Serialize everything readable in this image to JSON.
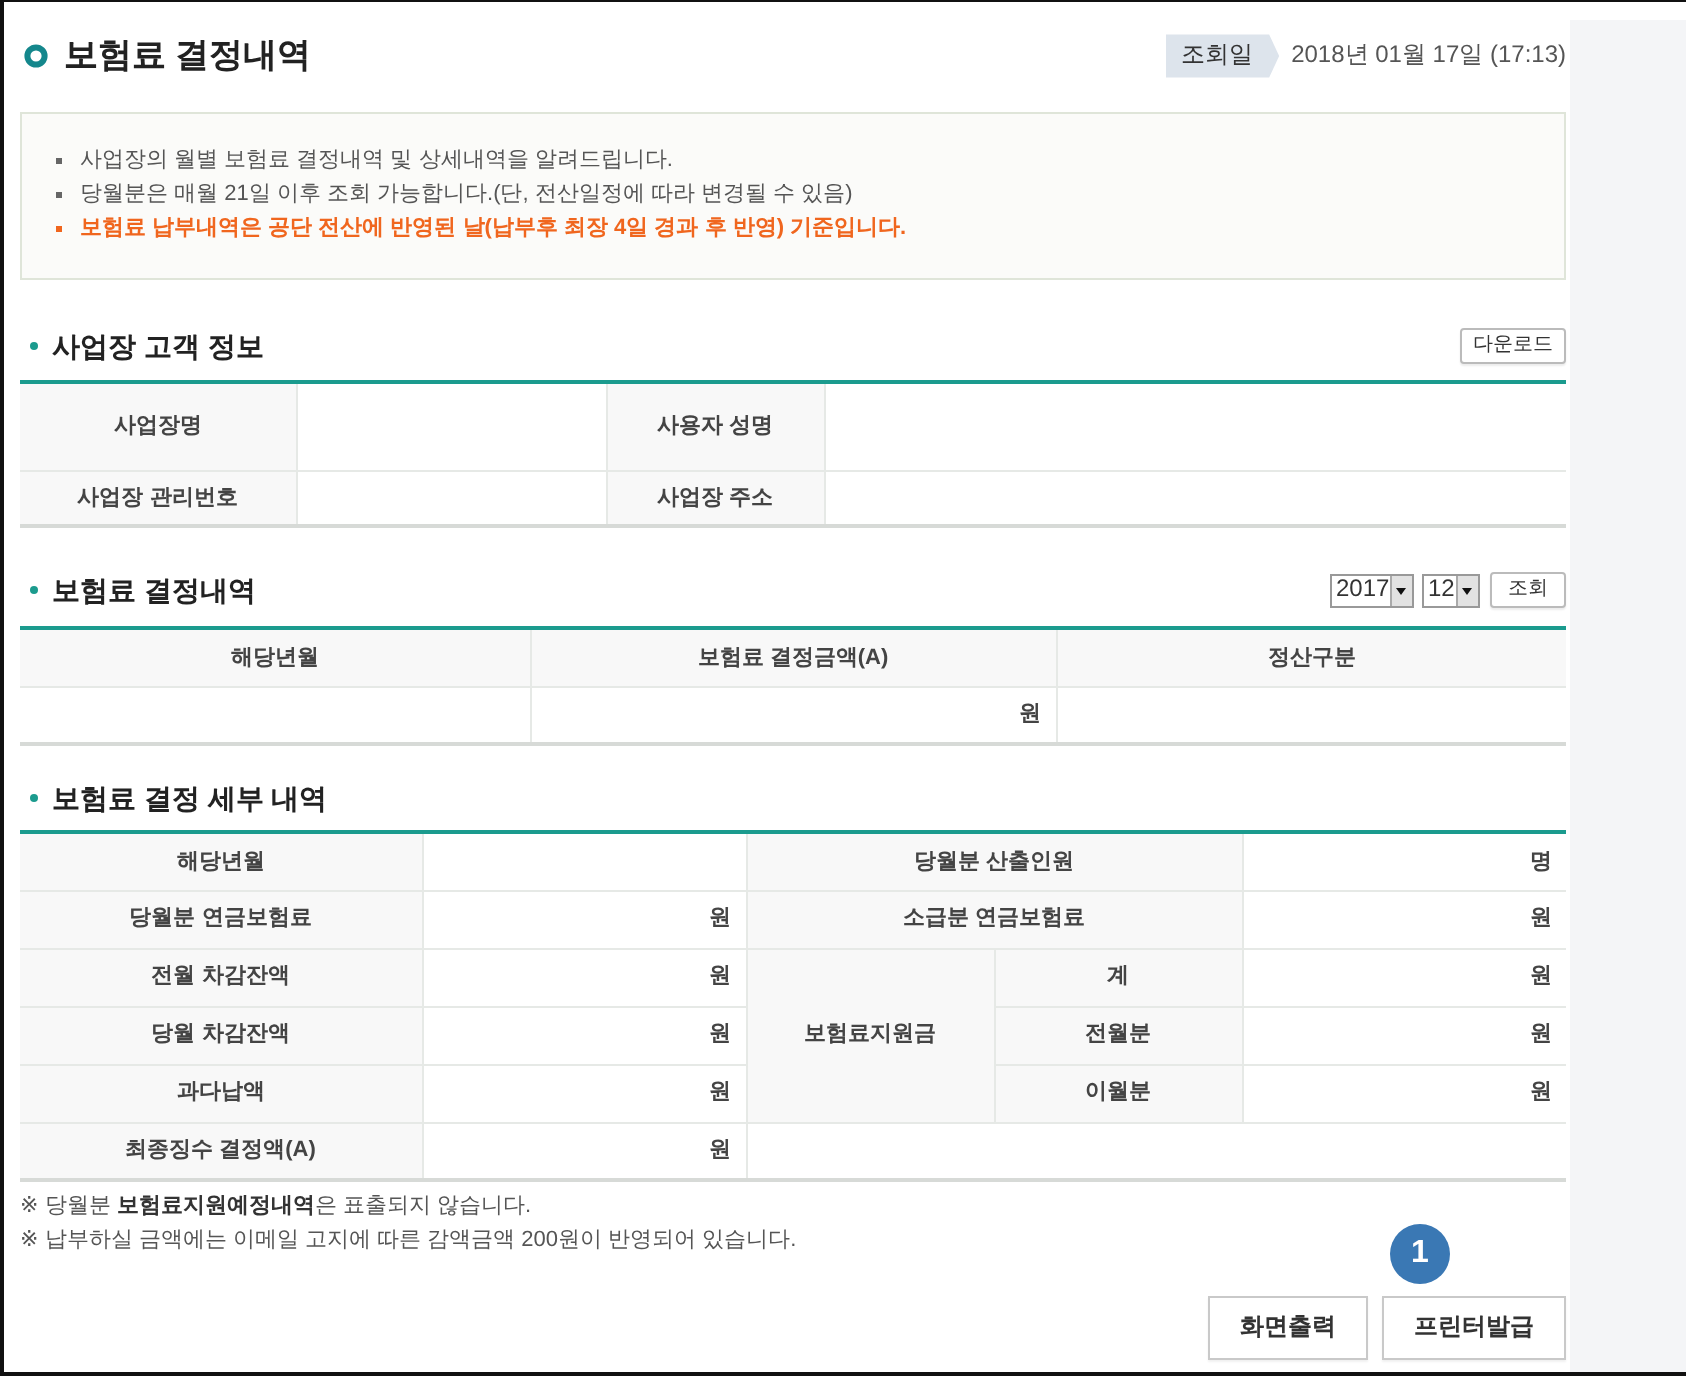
{
  "header": {
    "title": "보험료 결정내역",
    "query_date_label": "조회일",
    "query_date": "2018년 01월 17일 (17:13)"
  },
  "notices": [
    {
      "kind": "normal",
      "text": "사업장의 월별 보험료 결정내역 및 상세내역을 알려드립니다."
    },
    {
      "kind": "normal",
      "text": "당월분은 매월 21일 이후 조회 가능합니다.(단, 전산일정에 따라 변경될 수 있음)"
    },
    {
      "kind": "warning",
      "text": "보험료 납부내역은 공단 전산에 반영된 날(납부후 최장 4일 경과 후 반영) 기준입니다."
    }
  ],
  "customer_info": {
    "title": "사업장 고객 정보",
    "download_button": "다운로드",
    "fields": [
      {
        "label": "사업장명"
      },
      {
        "label": "사용자 성명"
      },
      {
        "label": "사업장 관리번호"
      },
      {
        "label": "사업장 주소"
      }
    ]
  },
  "decision": {
    "title": "보험료 결정내역",
    "year_select": "2017",
    "month_select": "12",
    "search_button": "조회",
    "columns": [
      "해당년월",
      "보험료 결정금액(A)",
      "정산구분"
    ],
    "rows": [
      {
        "amount": "원"
      }
    ]
  },
  "detail": {
    "title": "보험료 결정 세부 내역",
    "left": [
      {
        "label": "해당년월"
      },
      {
        "label": "당월분 연금보험료",
        "unit": "원"
      },
      {
        "label": "전월 차감잔액",
        "unit": "원"
      },
      {
        "label": "당월 차감잔액",
        "unit": "원"
      },
      {
        "label": "과다납액",
        "unit": "원"
      },
      {
        "label": "최종징수 결정액(A)",
        "unit": "원"
      }
    ],
    "right": [
      {
        "label": "당월분 산출인원",
        "unit": "명"
      },
      {
        "label": "소급분 연금보험료",
        "unit": "원"
      },
      {
        "label": "보험료지원금",
        "children": [
          {
            "label": "계",
            "unit": "원"
          },
          {
            "label": "전월분",
            "unit": "원"
          },
          {
            "label": "이월분",
            "unit": "원"
          }
        ]
      }
    ]
  },
  "notes": [
    "※ 당월분 **보험료지원예정내역**은 표출되지 않습니다.",
    "※ 납부하실 금액에는 이메일 고지에 따른 감액금액 200원이 반영되어 있습니다."
  ],
  "buttons": [
    {
      "label": "화면출력"
    },
    {
      "label": "프린터발급",
      "callout": "1"
    }
  ]
}
